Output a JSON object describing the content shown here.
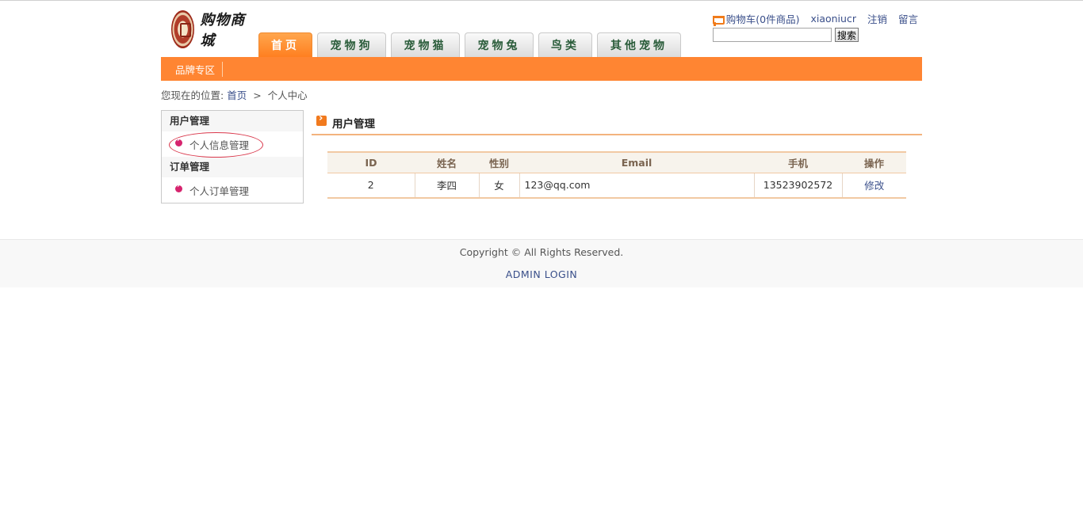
{
  "logo": {
    "text": "购物商城"
  },
  "nav": {
    "tabs": [
      {
        "label": "首页",
        "active": true
      },
      {
        "label": "宠物狗",
        "active": false
      },
      {
        "label": "宠物猫",
        "active": false
      },
      {
        "label": "宠物兔",
        "active": false
      },
      {
        "label": "鸟类",
        "active": false
      },
      {
        "label": "其他宠物",
        "active": false
      }
    ]
  },
  "top_links": {
    "cart_label": "购物车(0件商品)",
    "username": "xiaoniucr",
    "logout": "注销",
    "message": "留言"
  },
  "search": {
    "value": "",
    "button_label": "搜索"
  },
  "orange_bar": {
    "brand_label": "品牌专区"
  },
  "breadcrumb": {
    "prefix": "您现在的位置:",
    "home": "首页",
    "separator": ">",
    "current": "个人中心"
  },
  "sidebar": {
    "groups": [
      {
        "title": "用户管理",
        "items": [
          {
            "label": "个人信息管理",
            "selected": true
          }
        ]
      },
      {
        "title": "订单管理",
        "items": [
          {
            "label": "个人订单管理",
            "selected": false
          }
        ]
      }
    ]
  },
  "section": {
    "title": "用户管理"
  },
  "table": {
    "headers": [
      "ID",
      "姓名",
      "性别",
      "Email",
      "手机",
      "操作"
    ],
    "rows": [
      [
        "2",
        "李四",
        "女",
        "123@qq.com",
        "13523902572",
        "修改"
      ]
    ]
  },
  "footer": {
    "copyright": "Copyright © All Rights Reserved.",
    "admin_login": "ADMIN LOGIN"
  },
  "colors": {
    "accent_orange": "#ff8532",
    "link_blue": "#3a4f8a",
    "bullet_pink": "#d6246e"
  }
}
